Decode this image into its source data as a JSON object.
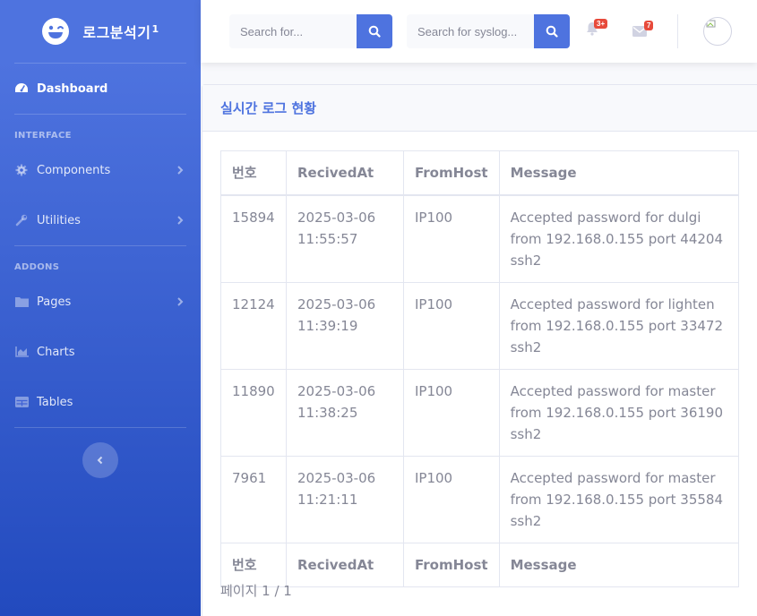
{
  "brand": {
    "name": "로그분석기",
    "sup": "1"
  },
  "sidebar": {
    "dashboard": "Dashboard",
    "heading_interface": "INTERFACE",
    "components": "Components",
    "utilities": "Utilities",
    "heading_addons": "ADDONS",
    "pages": "Pages",
    "charts": "Charts",
    "tables": "Tables"
  },
  "topbar": {
    "search1_placeholder": "Search for...",
    "search2_placeholder": "Search for syslog...",
    "alerts_count": "3+",
    "messages_count": "7"
  },
  "card": {
    "title": "실시간 로그 현황",
    "columns": [
      "번호",
      "RecivedAt",
      "FromHost",
      "Message"
    ],
    "rows": [
      [
        "15894",
        "2025-03-06 11:55:57",
        "IP100",
        "Accepted password for dulgi from 192.168.0.155 port 44204 ssh2"
      ],
      [
        "12124",
        "2025-03-06 11:39:19",
        "IP100",
        "Accepted password for lighten from 192.168.0.155 port 33472 ssh2"
      ],
      [
        "11890",
        "2025-03-06 11:38:25",
        "IP100",
        "Accepted password for master from 192.168.0.155 port 36190 ssh2"
      ],
      [
        "7961",
        "2025-03-06 11:21:11",
        "IP100",
        "Accepted password for master from 192.168.0.155 port 35584 ssh2"
      ]
    ],
    "pagination": "페이지 1 / 1"
  },
  "colors": {
    "primary": "#4e73df",
    "primary_dark": "#224abe",
    "danger": "#e74a3b",
    "text": "#858796"
  }
}
